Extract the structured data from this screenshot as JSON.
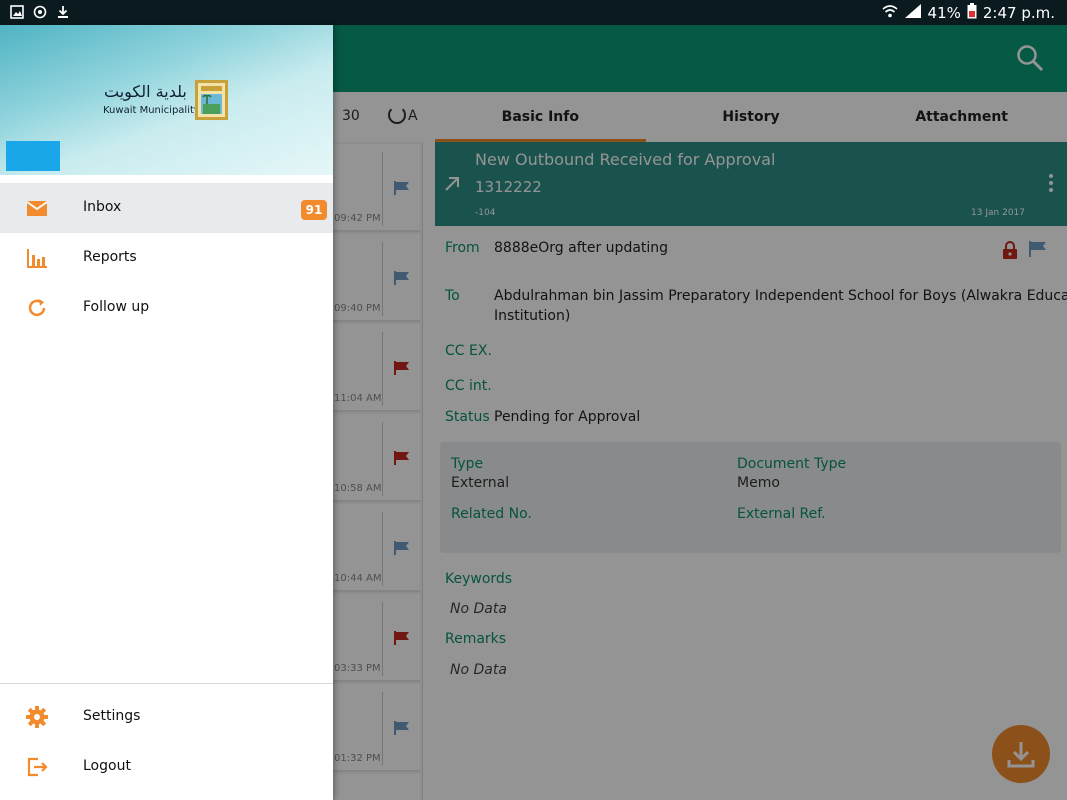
{
  "status_bar": {
    "battery": "41%",
    "time": "2:47 p.m.",
    "left_icons": [
      "gallery-icon",
      "sync-icon",
      "download-icon"
    ],
    "right_icons": [
      "wifi-icon",
      "signal-icon",
      "battery-icon"
    ]
  },
  "colors": {
    "app_bar": "#0c9a77",
    "accent": "#f28a2e",
    "header_card": "#2e8f86",
    "label_green": "#0b8f6e"
  },
  "list_toolbar": {
    "count": "30",
    "refresh_label": "A"
  },
  "mail_list": [
    {
      "time": "09:42 PM",
      "flag_color": "#6f9cc4"
    },
    {
      "time": "09:40 PM",
      "flag_color": "#6f9cc4"
    },
    {
      "time": "11:04 AM",
      "flag_color": "#c2281f"
    },
    {
      "time": "10:58 AM",
      "flag_color": "#c2281f"
    },
    {
      "time": "10:44 AM",
      "flag_color": "#6f9cc4"
    },
    {
      "time": "03:33 PM",
      "flag_color": "#c2281f"
    },
    {
      "time": "01:32 PM",
      "flag_color": "#6f9cc4"
    }
  ],
  "detail": {
    "tabs": [
      "Basic Info",
      "History",
      "Attachment"
    ],
    "active_tab": "Basic Info",
    "card": {
      "title": "New Outbound Received for Approval",
      "code": "1312222",
      "number": "-104",
      "date": "13 Jan 2017"
    },
    "from_label": "From",
    "from_value": "8888eOrg after updating",
    "to_label": "To",
    "to_value": "Abdulrahman bin Jassim Preparatory Independent School for Boys (Alwakra Educati",
    "to_value_line2": "Institution)",
    "cc_ex_label": "CC EX.",
    "cc_int_label": "CC int.",
    "status_label": "Status",
    "status_value": "Pending for Approval",
    "info": {
      "type_label": "Type",
      "type_value": "External",
      "doctype_label": "Document Type",
      "doctype_value": "Memo",
      "related_label": "Related No.",
      "extref_label": "External Ref."
    },
    "keywords_label": "Keywords",
    "keywords_value": "No Data",
    "remarks_label": "Remarks",
    "remarks_value": "No Data"
  },
  "drawer": {
    "logo_arabic": "بلدية الكويت",
    "logo_english": "Kuwait Municipality",
    "items": [
      {
        "label": "Inbox",
        "icon": "mail-icon",
        "badge": "91"
      },
      {
        "label": "Reports",
        "icon": "bar-chart-icon"
      },
      {
        "label": "Follow up",
        "icon": "refresh-icon"
      }
    ],
    "footer_items": [
      {
        "label": "Settings",
        "icon": "gear-icon"
      },
      {
        "label": "Logout",
        "icon": "logout-icon"
      }
    ]
  }
}
